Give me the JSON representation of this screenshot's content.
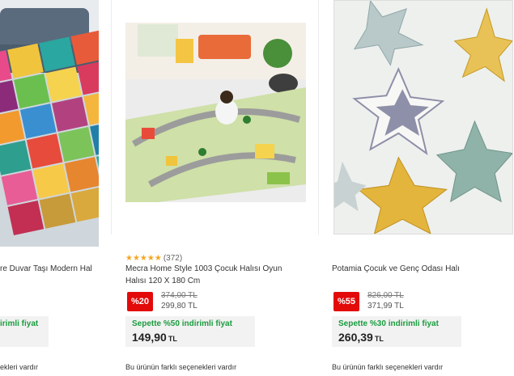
{
  "products": [
    {
      "title": "re Duvar Taşı Modern Hal",
      "basket_text": "irimli fiyat",
      "variants": "ekleri vardır"
    },
    {
      "rating_count": "(372)",
      "title_line1": "Mecra Home Style 1003 Çocuk Halısı Oyun",
      "title_line2": "Halısı 120 X 180 Cm",
      "discount": "%20",
      "old_price": "374,00 TL",
      "new_price": "299,80 TL",
      "basket_text": "Sepette %50 indirimli fiyat",
      "basket_price": "149,90",
      "currency": "TL",
      "variants": "Bu ürünün farklı seçenekleri vardır"
    },
    {
      "title": "Potamia Çocuk ve Genç Odası Halı",
      "discount": "%55",
      "old_price": "826,00 TL",
      "new_price": "371,99 TL",
      "basket_text": "Sepette %30 indirimli fiyat",
      "basket_price": "260,39",
      "currency": "TL",
      "variants": "Bu ürünün farklı seçenekleri vardır"
    }
  ],
  "stars": "★★★★★",
  "colors": {
    "discount_bg": "#e30a0a",
    "basket_green": "#1a9c3e",
    "star": "#f5a623"
  }
}
